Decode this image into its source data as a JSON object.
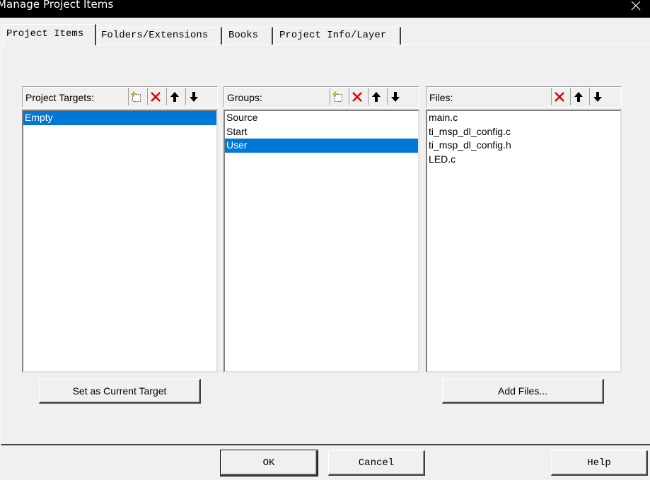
{
  "window": {
    "title": "Manage Project Items"
  },
  "tabs": [
    {
      "label": "Project Items",
      "active": true
    },
    {
      "label": "Folders/Extensions",
      "active": false
    },
    {
      "label": "Books",
      "active": false
    },
    {
      "label": "Project Info/Layer",
      "active": false
    }
  ],
  "targets": {
    "label": "Project Targets:",
    "items": [
      "Empty"
    ],
    "selected_index": 0,
    "toolbar": [
      "new-icon",
      "delete-icon",
      "move-up-icon",
      "move-down-icon"
    ]
  },
  "groups": {
    "label": "Groups:",
    "items": [
      "Source",
      "Start",
      "User"
    ],
    "selected_index": 2,
    "toolbar": [
      "new-icon",
      "delete-icon",
      "move-up-icon",
      "move-down-icon"
    ]
  },
  "files": {
    "label": "Files:",
    "items": [
      "main.c",
      "ti_msp_dl_config.c",
      "ti_msp_dl_config.h",
      "LED.c"
    ],
    "toolbar": [
      "delete-icon",
      "move-up-icon",
      "move-down-icon"
    ]
  },
  "buttons": {
    "set_current_target": "Set as Current Target",
    "add_files": "Add Files...",
    "ok": "OK",
    "cancel": "Cancel",
    "help": "Help"
  },
  "colors": {
    "selection": "#0078d7",
    "delete_icon": "#e00000",
    "new_icon_star": "#f2c200"
  }
}
